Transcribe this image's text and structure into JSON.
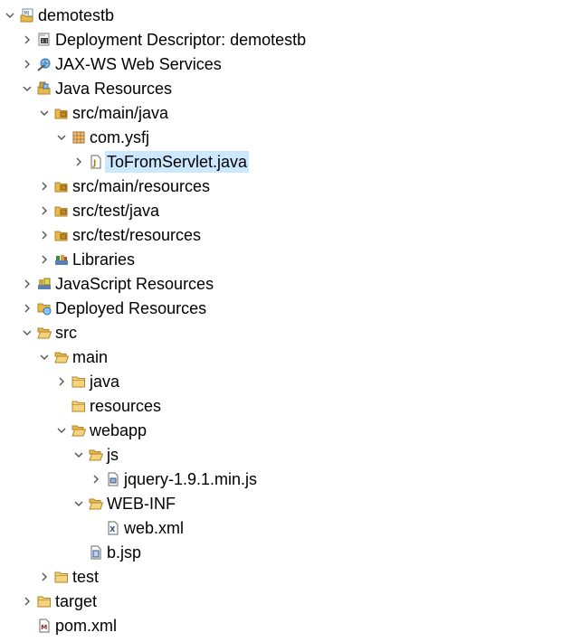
{
  "tree": [
    {
      "label": "demotestb",
      "toggle": "expanded",
      "icon": "project-icon"
    },
    {
      "label": "Deployment Descriptor: demotestb",
      "toggle": "collapsed",
      "icon": "deployment-descriptor-icon"
    },
    {
      "label": "JAX-WS Web Services",
      "toggle": "collapsed",
      "icon": "web-services-icon"
    },
    {
      "label": "Java Resources",
      "toggle": "expanded",
      "icon": "java-resources-icon"
    },
    {
      "label": "src/main/java",
      "toggle": "expanded",
      "icon": "source-folder-icon"
    },
    {
      "label": "com.ysfj",
      "toggle": "expanded",
      "icon": "package-icon"
    },
    {
      "label": "ToFromServlet.java",
      "toggle": "collapsed",
      "icon": "java-file-icon",
      "selected": true
    },
    {
      "label": "src/main/resources",
      "toggle": "collapsed",
      "icon": "source-folder-icon"
    },
    {
      "label": "src/test/java",
      "toggle": "collapsed",
      "icon": "source-folder-icon"
    },
    {
      "label": "src/test/resources",
      "toggle": "collapsed",
      "icon": "source-folder-icon"
    },
    {
      "label": "Libraries",
      "toggle": "collapsed",
      "icon": "libraries-icon"
    },
    {
      "label": "JavaScript Resources",
      "toggle": "collapsed",
      "icon": "javascript-resources-icon"
    },
    {
      "label": "Deployed Resources",
      "toggle": "collapsed",
      "icon": "deployed-resources-icon"
    },
    {
      "label": "src",
      "toggle": "expanded",
      "icon": "folder-open-icon"
    },
    {
      "label": "main",
      "toggle": "expanded",
      "icon": "folder-open-icon"
    },
    {
      "label": "java",
      "toggle": "collapsed",
      "icon": "folder-icon"
    },
    {
      "label": "resources",
      "toggle": "none",
      "icon": "folder-icon"
    },
    {
      "label": "webapp",
      "toggle": "expanded",
      "icon": "folder-open-icon"
    },
    {
      "label": "js",
      "toggle": "expanded",
      "icon": "folder-open-icon"
    },
    {
      "label": "jquery-1.9.1.min.js",
      "toggle": "collapsed",
      "icon": "js-file-icon"
    },
    {
      "label": "WEB-INF",
      "toggle": "expanded",
      "icon": "folder-open-icon"
    },
    {
      "label": "web.xml",
      "toggle": "none",
      "icon": "xml-file-icon"
    },
    {
      "label": "b.jsp",
      "toggle": "none",
      "icon": "jsp-file-icon"
    },
    {
      "label": "test",
      "toggle": "collapsed",
      "icon": "folder-icon"
    },
    {
      "label": "target",
      "toggle": "collapsed",
      "icon": "folder-icon"
    },
    {
      "label": "pom.xml",
      "toggle": "none",
      "icon": "maven-pom-icon"
    }
  ],
  "colors": {
    "selection": "#cce8ff",
    "folder": "#e8b84a",
    "chevron": "#555555"
  }
}
